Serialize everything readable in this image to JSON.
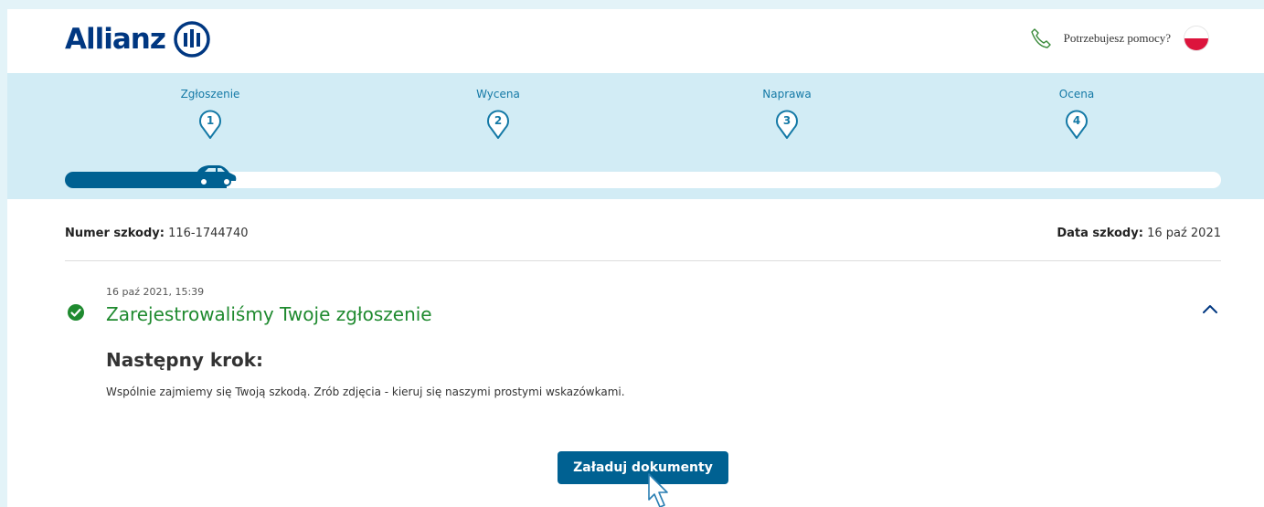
{
  "header": {
    "brand": "Allianz",
    "help_text": "Potrzebujesz pomocy?",
    "phone_icon": "phone-icon",
    "flag_icon": "poland-flag-icon"
  },
  "progress": {
    "steps": [
      {
        "label": "Zgłoszenie",
        "number": "1"
      },
      {
        "label": "Wycena",
        "number": "2"
      },
      {
        "label": "Naprawa",
        "number": "3"
      },
      {
        "label": "Ocena",
        "number": "4"
      }
    ],
    "current_step": 1,
    "progress_fraction": 0.14,
    "colors": {
      "accent": "#006192",
      "band": "#d2ecf5",
      "pin": "#1479a6"
    }
  },
  "claim": {
    "number_label": "Numer szkody:",
    "number_value": "116-1744740",
    "date_label": "Data szkody:",
    "date_value": "16 paź 2021"
  },
  "event": {
    "timestamp": "16 paź 2021, 15:39",
    "title": "Zarejestrowaliśmy Twoje zgłoszenie",
    "status_color": "#1f8a2f",
    "next_heading": "Następny krok:",
    "next_text": "Wspólnie zajmiemy się Twoją szkodą. Zrób zdjęcia - kieruj się naszymi prostymi wskazówkami.",
    "upload_button": "Załaduj dokumenty"
  }
}
